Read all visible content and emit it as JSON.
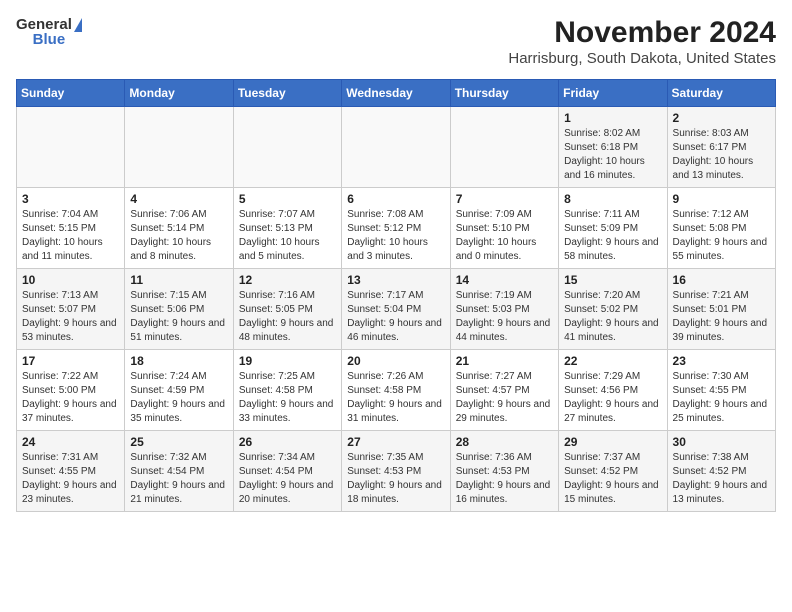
{
  "header": {
    "logo_general": "General",
    "logo_blue": "Blue",
    "title": "November 2024",
    "subtitle": "Harrisburg, South Dakota, United States"
  },
  "days_of_week": [
    "Sunday",
    "Monday",
    "Tuesday",
    "Wednesday",
    "Thursday",
    "Friday",
    "Saturday"
  ],
  "weeks": [
    [
      {
        "day": "",
        "info": ""
      },
      {
        "day": "",
        "info": ""
      },
      {
        "day": "",
        "info": ""
      },
      {
        "day": "",
        "info": ""
      },
      {
        "day": "",
        "info": ""
      },
      {
        "day": "1",
        "info": "Sunrise: 8:02 AM\nSunset: 6:18 PM\nDaylight: 10 hours and 16 minutes."
      },
      {
        "day": "2",
        "info": "Sunrise: 8:03 AM\nSunset: 6:17 PM\nDaylight: 10 hours and 13 minutes."
      }
    ],
    [
      {
        "day": "3",
        "info": "Sunrise: 7:04 AM\nSunset: 5:15 PM\nDaylight: 10 hours and 11 minutes."
      },
      {
        "day": "4",
        "info": "Sunrise: 7:06 AM\nSunset: 5:14 PM\nDaylight: 10 hours and 8 minutes."
      },
      {
        "day": "5",
        "info": "Sunrise: 7:07 AM\nSunset: 5:13 PM\nDaylight: 10 hours and 5 minutes."
      },
      {
        "day": "6",
        "info": "Sunrise: 7:08 AM\nSunset: 5:12 PM\nDaylight: 10 hours and 3 minutes."
      },
      {
        "day": "7",
        "info": "Sunrise: 7:09 AM\nSunset: 5:10 PM\nDaylight: 10 hours and 0 minutes."
      },
      {
        "day": "8",
        "info": "Sunrise: 7:11 AM\nSunset: 5:09 PM\nDaylight: 9 hours and 58 minutes."
      },
      {
        "day": "9",
        "info": "Sunrise: 7:12 AM\nSunset: 5:08 PM\nDaylight: 9 hours and 55 minutes."
      }
    ],
    [
      {
        "day": "10",
        "info": "Sunrise: 7:13 AM\nSunset: 5:07 PM\nDaylight: 9 hours and 53 minutes."
      },
      {
        "day": "11",
        "info": "Sunrise: 7:15 AM\nSunset: 5:06 PM\nDaylight: 9 hours and 51 minutes."
      },
      {
        "day": "12",
        "info": "Sunrise: 7:16 AM\nSunset: 5:05 PM\nDaylight: 9 hours and 48 minutes."
      },
      {
        "day": "13",
        "info": "Sunrise: 7:17 AM\nSunset: 5:04 PM\nDaylight: 9 hours and 46 minutes."
      },
      {
        "day": "14",
        "info": "Sunrise: 7:19 AM\nSunset: 5:03 PM\nDaylight: 9 hours and 44 minutes."
      },
      {
        "day": "15",
        "info": "Sunrise: 7:20 AM\nSunset: 5:02 PM\nDaylight: 9 hours and 41 minutes."
      },
      {
        "day": "16",
        "info": "Sunrise: 7:21 AM\nSunset: 5:01 PM\nDaylight: 9 hours and 39 minutes."
      }
    ],
    [
      {
        "day": "17",
        "info": "Sunrise: 7:22 AM\nSunset: 5:00 PM\nDaylight: 9 hours and 37 minutes."
      },
      {
        "day": "18",
        "info": "Sunrise: 7:24 AM\nSunset: 4:59 PM\nDaylight: 9 hours and 35 minutes."
      },
      {
        "day": "19",
        "info": "Sunrise: 7:25 AM\nSunset: 4:58 PM\nDaylight: 9 hours and 33 minutes."
      },
      {
        "day": "20",
        "info": "Sunrise: 7:26 AM\nSunset: 4:58 PM\nDaylight: 9 hours and 31 minutes."
      },
      {
        "day": "21",
        "info": "Sunrise: 7:27 AM\nSunset: 4:57 PM\nDaylight: 9 hours and 29 minutes."
      },
      {
        "day": "22",
        "info": "Sunrise: 7:29 AM\nSunset: 4:56 PM\nDaylight: 9 hours and 27 minutes."
      },
      {
        "day": "23",
        "info": "Sunrise: 7:30 AM\nSunset: 4:55 PM\nDaylight: 9 hours and 25 minutes."
      }
    ],
    [
      {
        "day": "24",
        "info": "Sunrise: 7:31 AM\nSunset: 4:55 PM\nDaylight: 9 hours and 23 minutes."
      },
      {
        "day": "25",
        "info": "Sunrise: 7:32 AM\nSunset: 4:54 PM\nDaylight: 9 hours and 21 minutes."
      },
      {
        "day": "26",
        "info": "Sunrise: 7:34 AM\nSunset: 4:54 PM\nDaylight: 9 hours and 20 minutes."
      },
      {
        "day": "27",
        "info": "Sunrise: 7:35 AM\nSunset: 4:53 PM\nDaylight: 9 hours and 18 minutes."
      },
      {
        "day": "28",
        "info": "Sunrise: 7:36 AM\nSunset: 4:53 PM\nDaylight: 9 hours and 16 minutes."
      },
      {
        "day": "29",
        "info": "Sunrise: 7:37 AM\nSunset: 4:52 PM\nDaylight: 9 hours and 15 minutes."
      },
      {
        "day": "30",
        "info": "Sunrise: 7:38 AM\nSunset: 4:52 PM\nDaylight: 9 hours and 13 minutes."
      }
    ]
  ]
}
